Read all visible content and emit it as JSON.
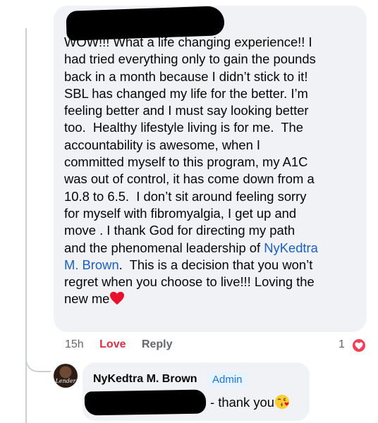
{
  "comment": {
    "text_lines": [
      "WOW!!! What a life changing experience!! I",
      "had tried everything only to gain the pounds",
      "back in a month because I didn’t stick to it!",
      "SBL has changed my life for the better. I’m",
      "feeling better and I must say looking better",
      "too.  Healthy lifestyle living is for me.  The",
      "accountability is awesome, when I",
      "committed myself to this program, my A1C",
      "was out of control, it has come down from a",
      "10.8 to 6.5.  I don’t sit around feeling sorry",
      "for myself with fibromyalgia, I get up and",
      "move . I thank God for directing my path",
      "and the phenomenal leadership of "
    ],
    "mention_part1": "NyKedtra",
    "mention_part2": "M. Brown",
    "after_mention": ".  This is a decision that you won’t",
    "line_15": "regret when you choose to live!!! Loving the",
    "line_16": "new me",
    "end_emoji": "red-heart-emoji",
    "timestamp": "15h",
    "love_label": "Love",
    "reply_label": "Reply",
    "reaction_count": "1",
    "reaction_icon": "heart-reaction-icon"
  },
  "reply": {
    "author": "NyKedtra M. Brown",
    "badge": "Admin",
    "avatar_text": "Lender",
    "text": "- thank you",
    "end_emoji": "face-blowing-kiss-emoji"
  },
  "colors": {
    "bubble_bg": "#f0f2f5",
    "mention": "#1b5fbf",
    "love": "#d92f44",
    "reaction_badge": "#f33e58",
    "admin_badge_bg": "#e7f3ff",
    "admin_badge_text": "#1b74e4"
  }
}
